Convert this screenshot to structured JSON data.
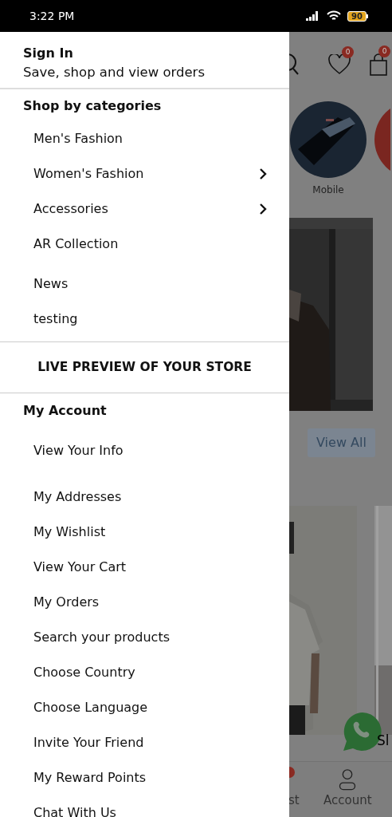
{
  "status_bar": {
    "time": "3:22 PM",
    "battery": "90"
  },
  "drawer": {
    "sign_in": {
      "title": "Sign In",
      "subtitle": "Save, shop and view orders"
    },
    "categories": {
      "heading": "Shop by categories",
      "items": [
        {
          "label": "Men's Fashion",
          "expandable": false
        },
        {
          "label": "Women's Fashion",
          "expandable": true
        },
        {
          "label": "Accessories",
          "expandable": true
        },
        {
          "label": "AR Collection",
          "expandable": false
        },
        {
          "label": "News",
          "expandable": false
        },
        {
          "label": "testing",
          "expandable": false
        }
      ]
    },
    "live_preview": "LIVE PREVIEW OF YOUR STORE",
    "account": {
      "heading": "My Account",
      "items": [
        "View Your Info",
        "My Addresses",
        "My Wishlist",
        "View Your Cart",
        "My Orders",
        "Search your products",
        "Choose Country",
        "Choose Language",
        "Invite Your Friend",
        "My Reward Points",
        "Chat With Us"
      ]
    }
  },
  "background": {
    "wishlist_badge": "0",
    "cart_badge": "0",
    "category_label": "Mobile",
    "view_all": "View All",
    "cut_text": "Sl",
    "nav_labels": [
      "st",
      "Account"
    ]
  }
}
